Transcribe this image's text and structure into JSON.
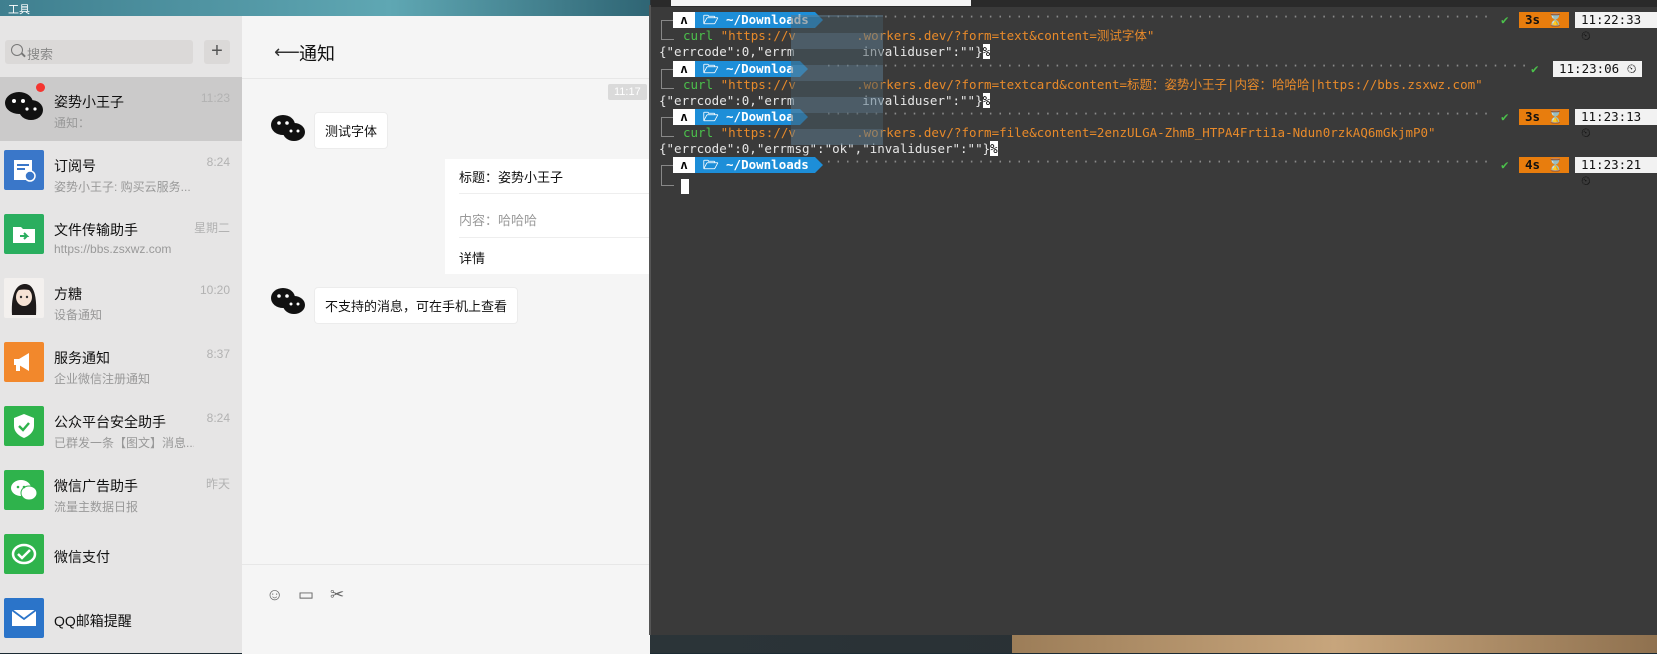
{
  "desktop": {
    "top_label": "工具"
  },
  "wechat": {
    "search_placeholder": "搜索",
    "add_label": "+",
    "conversations": [
      {
        "name": "姿势小王子",
        "sub": "通知：",
        "time": "11:23",
        "avatar_color": "#cbcaca"
      },
      {
        "name": "订阅号",
        "sub": "姿势小王子: 购买云服务...",
        "time": "8:24",
        "avatar_color": "#3a77c9"
      },
      {
        "name": "文件传输助手",
        "sub": "https://bbs.zsxwz.com",
        "time": "星期二",
        "avatar_color": "#2aae5f"
      },
      {
        "name": "方糖",
        "sub": "设备通知",
        "time": "10:20",
        "avatar_color": "#ffffff"
      },
      {
        "name": "服务通知",
        "sub": "企业微信注册通知",
        "time": "8:37",
        "avatar_color": "#f2882c"
      },
      {
        "name": "公众平台安全助手",
        "sub": "已群发一条【图文】消息...",
        "time": "8:24",
        "avatar_color": "#2fb34c"
      },
      {
        "name": "微信广告助手",
        "sub": "流量主数据日报",
        "time": "昨天",
        "avatar_color": "#2fb34c"
      },
      {
        "name": "微信支付",
        "sub": "",
        "time": "",
        "avatar_color": "#2fb34c"
      },
      {
        "name": "QQ邮箱提醒",
        "sub": "",
        "time": "",
        "avatar_color": "#2b74c9"
      }
    ],
    "chat": {
      "title": "通知",
      "timestamp": "11:17",
      "msg1": "测试字体",
      "card": {
        "title": "标题：姿势小王子",
        "content": "内容：哈哈哈",
        "details": "详情"
      },
      "msg2": "不支持的消息，可在手机上查看"
    }
  },
  "terminal": {
    "dir": "🗁 ~/Downloads",
    "dir_cut": "🗁 ~/Downloa",
    "blocks": [
      {
        "ok": "✔",
        "dur": "3s ⌛",
        "time": "11:22:33 ⏲",
        "cmd_prefix": "curl ",
        "cmd": "\"https://v        .workers.dev/?form=text&content=测试字体\"",
        "out": "{\"errcode\":0,\"errm         invaliduser\":\"\"}",
        "pct": "%"
      },
      {
        "ok": "✔",
        "dur": "",
        "time": "11:23:06 ⏲",
        "cmd_prefix": "curl ",
        "cmd": "\"https://v        .workers.dev/?form=textcard&content=标题：姿势小王子|内容：哈哈哈|https://bbs.zsxwz.com\"",
        "out": "{\"errcode\":0,\"errm         invaliduser\":\"\"}",
        "pct": "%"
      },
      {
        "ok": "✔",
        "dur": "3s ⌛",
        "time": "11:23:13 ⏲",
        "cmd_prefix": "curl ",
        "cmd": "\"https://v        .workers.dev/?form=file&content=2enzULGA-ZhmB_HTPA4Frti1a-Ndun0rzkAQ6mGkjmP0\"",
        "out": "{\"errcode\":0,\"errmsg\":\"ok\",\"invaliduser\":\"\"}",
        "pct": "%"
      },
      {
        "ok": "✔",
        "dur": "4s ⌛",
        "time": "11:23:21 ⏲"
      }
    ]
  }
}
